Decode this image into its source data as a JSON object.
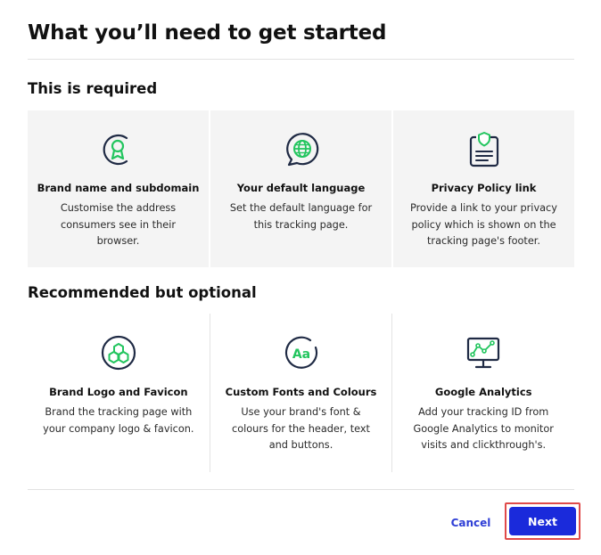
{
  "title": "What you’ll need to get started",
  "required": {
    "heading": "This is required",
    "items": [
      {
        "icon": "award-badge-icon",
        "title": "Brand name and subdomain",
        "description": "Customise the address consumers see in their browser."
      },
      {
        "icon": "globe-chat-icon",
        "title": "Your default language",
        "description": "Set the default language for this tracking page."
      },
      {
        "icon": "shield-document-icon",
        "title": "Privacy Policy link",
        "description": "Provide a link to your privacy policy which is shown on the tracking page's footer."
      }
    ]
  },
  "optional": {
    "heading": "Recommended but optional",
    "items": [
      {
        "icon": "hexagon-logo-icon",
        "title": "Brand Logo and Favicon",
        "description": "Brand the tracking page with your company logo & favicon."
      },
      {
        "icon": "font-aa-icon",
        "title": "Custom Fonts and Colours",
        "description": "Use your brand's font & colours for the header, text and buttons."
      },
      {
        "icon": "analytics-monitor-icon",
        "title": "Google Analytics",
        "description": "Add your tracking ID from Google Analytics to monitor visits and clickthrough's."
      }
    ]
  },
  "actions": {
    "cancel": "Cancel",
    "next": "Next"
  },
  "colors": {
    "accent": "#1a2adb",
    "icon_green": "#22c55e",
    "icon_dark": "#1f2a44",
    "highlight": "#e04a4a"
  }
}
